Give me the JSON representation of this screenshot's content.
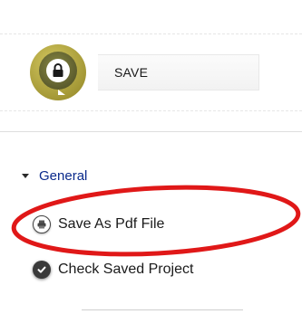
{
  "header": {
    "title": "SAVE",
    "icon": "lock-icon",
    "badge_colors": {
      "outer": "#b5a83c",
      "inner": "#6b6b33",
      "lock": "#1a1a1a"
    }
  },
  "menu": {
    "section": {
      "label": "General",
      "expanded": true,
      "color": "#0a2a8c"
    },
    "items": [
      {
        "label": "Save As Pdf File",
        "icon": "printer-icon",
        "highlighted": true
      },
      {
        "label": "Check Saved Project",
        "icon": "check-circle-icon",
        "highlighted": false
      }
    ]
  },
  "annotation": {
    "shape": "ellipse",
    "color": "#e01818"
  }
}
